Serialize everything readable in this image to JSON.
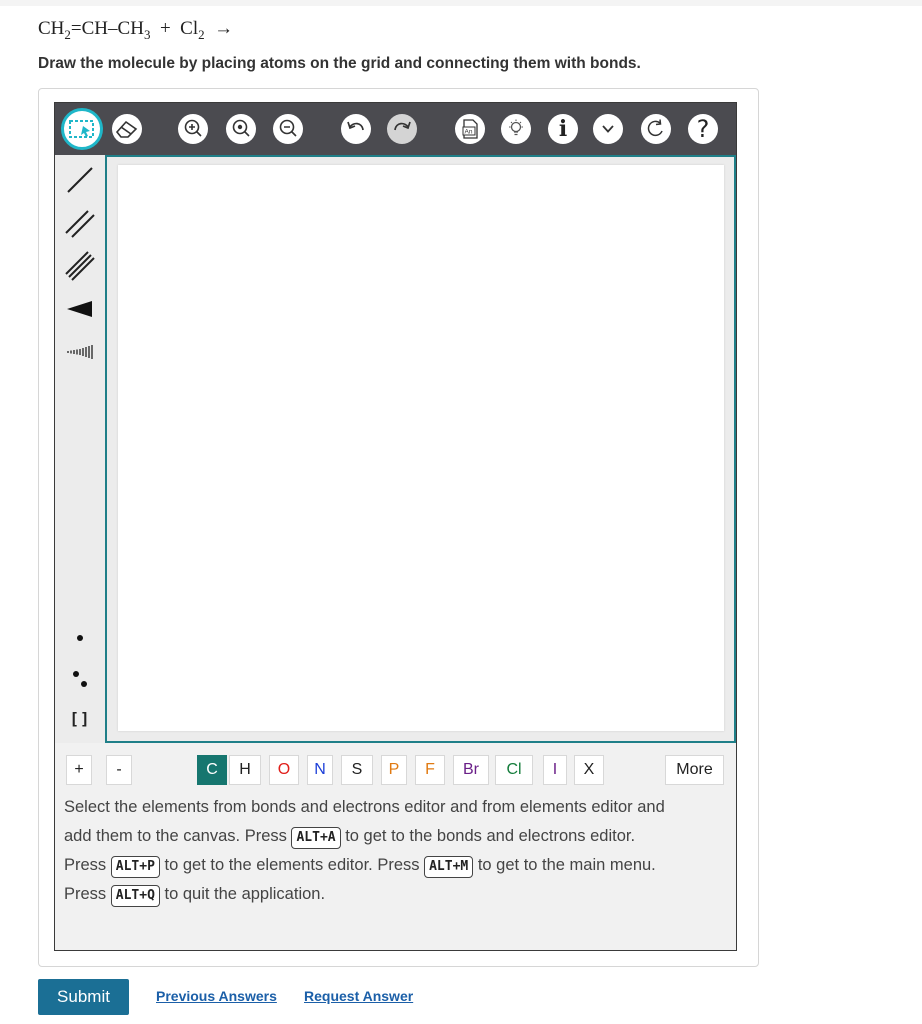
{
  "question": {
    "equation": {
      "r1_a": "CH",
      "r1_a_sub": "2",
      "bond1": "=",
      "r1_b": "CH",
      "bond2": "–",
      "r1_c": "CH",
      "r1_c_sub": "3",
      "plus": "+",
      "r2": "Cl",
      "r2_sub": "2",
      "arrow": "→"
    },
    "instruction": "Draw the molecule by placing atoms on the grid and connecting them with bonds."
  },
  "toolbar": {
    "buttons": [
      {
        "name": "selection-tool",
        "icon": "select-lasso-icon",
        "selected": true
      },
      {
        "name": "eraser-tool",
        "icon": "eraser-icon"
      },
      {
        "name": "zoom-in",
        "icon": "zoom-in-icon"
      },
      {
        "name": "zoom-reset",
        "icon": "zoom-reset-icon"
      },
      {
        "name": "zoom-out",
        "icon": "zoom-out-icon"
      },
      {
        "name": "undo",
        "icon": "undo-icon"
      },
      {
        "name": "redo",
        "icon": "redo-icon",
        "disabled": true
      },
      {
        "name": "templates",
        "icon": "document-icon",
        "label": "An"
      },
      {
        "name": "hint",
        "icon": "lightbulb-icon"
      },
      {
        "name": "info",
        "icon": "info-icon",
        "label": "i"
      },
      {
        "name": "more-menu",
        "icon": "chevron-down-icon"
      },
      {
        "name": "reset",
        "icon": "reset-icon"
      },
      {
        "name": "help",
        "icon": "help-icon",
        "label": "?"
      }
    ]
  },
  "left_tools": {
    "bonds": [
      "single-bond-icon",
      "double-bond-icon",
      "triple-bond-icon",
      "wedge-bond-icon",
      "hash-bond-icon"
    ],
    "electrons": [
      "radical-icon",
      "lone-pair-icon",
      "brackets-icon"
    ],
    "brackets_label": "[]"
  },
  "elements": {
    "charge_plus": "+",
    "charge_minus": "-",
    "items": [
      "C",
      "H",
      "O",
      "N",
      "S",
      "P",
      "F",
      "Br",
      "Cl",
      "I",
      "X"
    ],
    "selected": "C",
    "colors": {
      "C": "#ffffff",
      "H": "#222222",
      "O": "#e0201b",
      "N": "#1c3fd8",
      "S": "#222222",
      "P": "#e07a12",
      "F": "#e07a12",
      "Br": "#6a1f88",
      "Cl": "#157d3c",
      "I": "#6a1f88",
      "X": "#222222"
    },
    "more_label": "More"
  },
  "help": {
    "line1": "Select the elements from bonds and electrons editor and from elements editor and",
    "line2_a": "add them to the canvas. Press",
    "key_a": "ALT+A",
    "line2_b": "to get to the bonds and electrons editor.",
    "line3_a": "Press",
    "key_p": "ALT+P",
    "line3_b": "to get to the elements editor. Press",
    "key_m": "ALT+M",
    "line3_c": "to get to the main menu.",
    "line4_a": "Press",
    "key_q": "ALT+Q",
    "line4_b": "to quit the application."
  },
  "actions": {
    "submit": "Submit",
    "previous_answers": "Previous Answers",
    "request_answer": "Request Answer"
  },
  "theme": {
    "accent": "#1f7f88",
    "selected_element": "#16766f",
    "submit": "#1b6f95",
    "link": "#1b5fa8",
    "toolbar_bg": "#4b4b50",
    "tool_highlight": "#1fb7c9"
  }
}
